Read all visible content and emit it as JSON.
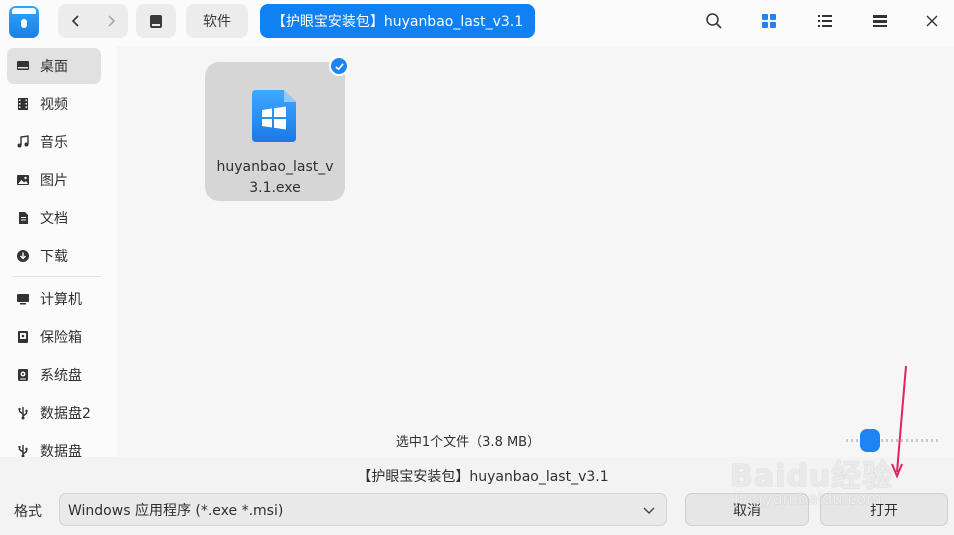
{
  "titlebar": {
    "breadcrumb_parent": "软件",
    "breadcrumb_current": "【护眼宝安装包】huyanbao_last_v3.1"
  },
  "sidebar": {
    "items": [
      {
        "label": "桌面",
        "icon": "desktop-icon"
      },
      {
        "label": "视频",
        "icon": "video-icon"
      },
      {
        "label": "音乐",
        "icon": "music-icon"
      },
      {
        "label": "图片",
        "icon": "picture-icon"
      },
      {
        "label": "文档",
        "icon": "document-icon"
      },
      {
        "label": "下载",
        "icon": "download-icon"
      },
      {
        "label": "计算机",
        "icon": "computer-icon"
      },
      {
        "label": "保险箱",
        "icon": "safe-icon"
      },
      {
        "label": "系统盘",
        "icon": "disk-icon"
      },
      {
        "label": "数据盘2",
        "icon": "usb-icon"
      },
      {
        "label": "数据盘",
        "icon": "usb-icon"
      }
    ],
    "active_label": "桌面"
  },
  "main": {
    "file_name": "huyanbao_last_v3.1.exe",
    "status": "选中1个文件（3.8 MB）"
  },
  "footer": {
    "filename_value": "【护眼宝安装包】huyanbao_last_v3.1",
    "format_label": "格式",
    "format_value": "Windows 应用程序 (*.exe *.msi)",
    "cancel_label": "取消",
    "open_label": "打开"
  },
  "watermark": {
    "line1": "Baidu经验",
    "line2": "jingyan.baidu.com"
  },
  "colors": {
    "accent": "#0f81f4",
    "annotation_arrow": "#e0245e"
  }
}
